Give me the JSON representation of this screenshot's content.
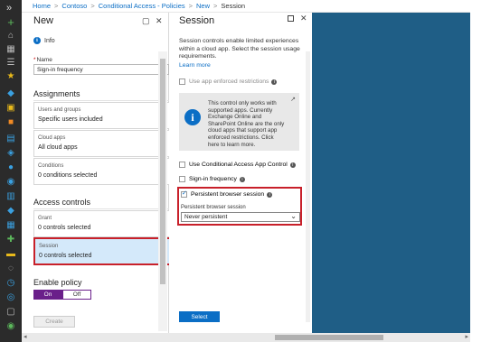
{
  "breadcrumb": [
    "Home",
    "Contoso",
    "Conditional Access - Policies",
    "New",
    "Session"
  ],
  "new_panel": {
    "title": "New",
    "info": "Info",
    "name_label": "Name",
    "name_value": "Sign-in frequency",
    "assignments_heading": "Assignments",
    "assignments": [
      {
        "key": "Users and groups",
        "value": "Specific users included"
      },
      {
        "key": "Cloud apps",
        "value": "All cloud apps"
      },
      {
        "key": "Conditions",
        "value": "0 conditions selected"
      }
    ],
    "access_heading": "Access controls",
    "access": [
      {
        "key": "Grant",
        "value": "0 controls selected"
      },
      {
        "key": "Session",
        "value": "0 controls selected"
      }
    ],
    "policy_heading": "Enable policy",
    "toggle_on": "On",
    "toggle_off": "Off",
    "create": "Create"
  },
  "session_panel": {
    "title": "Session",
    "description": "Session controls enable limited experiences within a cloud app. Select the session usage requirements.",
    "learn_more": "Learn more",
    "app_enforced": "Use app enforced restrictions",
    "callout": "This control only works with supported apps. Currently Exchange Online and SharePoint Online are the only cloud apps that support app enforced restrictions. Click here to learn more.",
    "cas_control": "Use Conditional Access App Control",
    "signin_frequency": "Sign-in frequency",
    "persistent_session": "Persistent browser session",
    "persistent_label": "Persistent browser session",
    "persistent_value": "Never persistent",
    "select": "Select"
  }
}
